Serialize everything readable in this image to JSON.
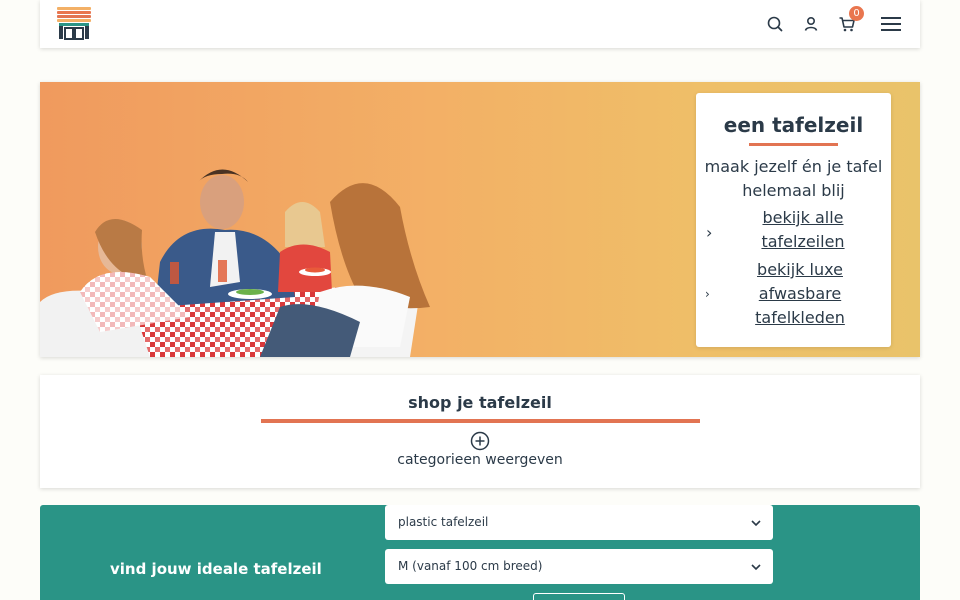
{
  "header": {
    "logo_icon": "store-awning-logo",
    "icons": [
      "search-icon",
      "user-icon",
      "cart-icon",
      "menu-icon"
    ],
    "cart_count": "0"
  },
  "hero": {
    "title": "een tafelzeil",
    "subtitle": "maak jezelf én je tafel helemaal blij",
    "links": [
      {
        "label": "bekijk alle tafelzeilen"
      },
      {
        "label": "bekijk luxe afwasbare tafelkleden"
      }
    ]
  },
  "shop": {
    "title": "shop je tafelzeil",
    "categories_label": "categorieen weergeven"
  },
  "finder": {
    "label": "vind jouw ideale tafelzeil",
    "select_material": "plastic tafelzeil",
    "select_size": "M (vanaf 100 cm breed)"
  },
  "colors": {
    "accent": "#e27452",
    "finder_bg": "#2a9486",
    "text": "#2b3a48"
  }
}
